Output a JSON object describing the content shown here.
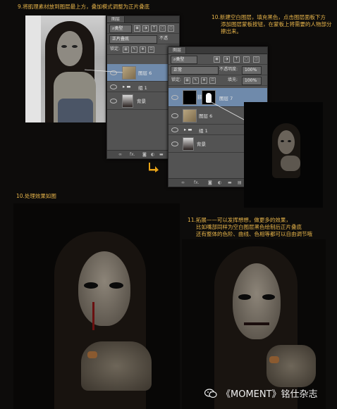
{
  "steps": {
    "step9": "9.将肌理素材放到图层最上方，叠加模式调整为正片叠底",
    "step10_line1": "10.新建空白图层，填充黑色，点击图层面板下方",
    "step10_line2": "添加图层蒙板按钮，在蒙板上将需要的人物部分",
    "step10_line3": "擦出来。",
    "step10_result": "10.处理效果如图",
    "step11_line1": "11.拓展——可以发挥想想，做更多的效果，",
    "step11_line2": "比如嘴部同样为空白图层黑色绘制后正片叠底",
    "step11_line3": "还有整体的色阶、曲线、色相等都可以自由调节哦"
  },
  "panel1": {
    "tab": "图层",
    "filter_label": "类型",
    "blend_mode": "正片叠底",
    "opacity_label": "不透",
    "lock_label": "锁定:",
    "layers": [
      {
        "name": "图层 6",
        "type": "texture",
        "selected": true
      },
      {
        "name": "组 1",
        "type": "group",
        "selected": false
      },
      {
        "name": "背景",
        "type": "photo",
        "selected": false
      }
    ]
  },
  "panel2": {
    "tab": "图层",
    "filter_label": "类型",
    "blend_mode": "正常",
    "opacity_label": "不透明度:",
    "opacity_value": "100%",
    "lock_label": "锁定:",
    "fill_label": "填充:",
    "fill_value": "100%",
    "layers": [
      {
        "name": "图层 7",
        "type": "mask",
        "selected": true
      },
      {
        "name": "图层 6",
        "type": "texture",
        "selected": false
      },
      {
        "name": "组 1",
        "type": "group",
        "selected": false
      },
      {
        "name": "背景",
        "type": "photo",
        "selected": false
      }
    ]
  },
  "watermark": "《MOMENT》铭仕杂志",
  "colors": {
    "caption": "#e8b54a",
    "panel": "#535353",
    "arrow": "#e8a317",
    "selected": "#6f8aab"
  }
}
